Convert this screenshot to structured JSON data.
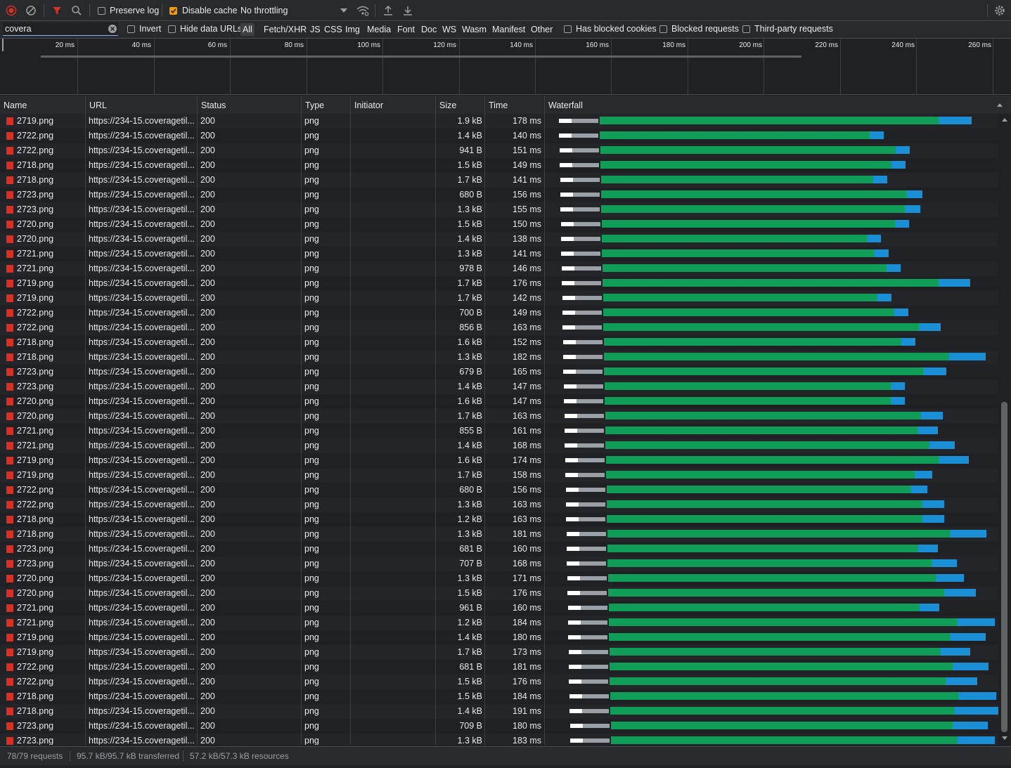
{
  "toolbar": {
    "preserve_log": "Preserve log",
    "disable_cache": "Disable cache",
    "throttling": "No throttling"
  },
  "filter": {
    "value": "covera",
    "invert": "Invert",
    "hide_data_urls": "Hide data URLs",
    "types": [
      "All",
      "Fetch/XHR",
      "JS",
      "CSS",
      "Img",
      "Media",
      "Font",
      "Doc",
      "WS",
      "Wasm",
      "Manifest",
      "Other"
    ],
    "has_blocked_cookies": "Has blocked cookies",
    "blocked_requests": "Blocked requests",
    "third_party": "Third-party requests"
  },
  "overview": {
    "ticks": [
      "20 ms",
      "40 ms",
      "60 ms",
      "80 ms",
      "100 ms",
      "120 ms",
      "140 ms",
      "160 ms",
      "180 ms",
      "200 ms",
      "220 ms",
      "240 ms",
      "260 ms"
    ]
  },
  "columns": {
    "name": "Name",
    "url": "URL",
    "status": "Status",
    "type": "Type",
    "initiator": "Initiator",
    "size": "Size",
    "time": "Time",
    "waterfall": "Waterfall"
  },
  "rows": [
    {
      "name": "2719.png",
      "url": "https://234-15.coveragetil...",
      "status": "200",
      "type": "png",
      "size": "1.9 kB",
      "time": "178 ms"
    },
    {
      "name": "2722.png",
      "url": "https://234-15.coveragetil...",
      "status": "200",
      "type": "png",
      "size": "1.4 kB",
      "time": "140 ms"
    },
    {
      "name": "2722.png",
      "url": "https://234-15.coveragetil...",
      "status": "200",
      "type": "png",
      "size": "941 B",
      "time": "151 ms"
    },
    {
      "name": "2718.png",
      "url": "https://234-15.coveragetil...",
      "status": "200",
      "type": "png",
      "size": "1.5 kB",
      "time": "149 ms"
    },
    {
      "name": "2718.png",
      "url": "https://234-15.coveragetil...",
      "status": "200",
      "type": "png",
      "size": "1.7 kB",
      "time": "141 ms"
    },
    {
      "name": "2723.png",
      "url": "https://234-15.coveragetil...",
      "status": "200",
      "type": "png",
      "size": "680 B",
      "time": "156 ms"
    },
    {
      "name": "2723.png",
      "url": "https://234-15.coveragetil...",
      "status": "200",
      "type": "png",
      "size": "1.3 kB",
      "time": "155 ms"
    },
    {
      "name": "2720.png",
      "url": "https://234-15.coveragetil...",
      "status": "200",
      "type": "png",
      "size": "1.5 kB",
      "time": "150 ms"
    },
    {
      "name": "2720.png",
      "url": "https://234-15.coveragetil...",
      "status": "200",
      "type": "png",
      "size": "1.4 kB",
      "time": "138 ms"
    },
    {
      "name": "2721.png",
      "url": "https://234-15.coveragetil...",
      "status": "200",
      "type": "png",
      "size": "1.3 kB",
      "time": "141 ms"
    },
    {
      "name": "2721.png",
      "url": "https://234-15.coveragetil...",
      "status": "200",
      "type": "png",
      "size": "978 B",
      "time": "146 ms"
    },
    {
      "name": "2719.png",
      "url": "https://234-15.coveragetil...",
      "status": "200",
      "type": "png",
      "size": "1.7 kB",
      "time": "176 ms"
    },
    {
      "name": "2719.png",
      "url": "https://234-15.coveragetil...",
      "status": "200",
      "type": "png",
      "size": "1.7 kB",
      "time": "142 ms"
    },
    {
      "name": "2722.png",
      "url": "https://234-15.coveragetil...",
      "status": "200",
      "type": "png",
      "size": "700 B",
      "time": "149 ms"
    },
    {
      "name": "2722.png",
      "url": "https://234-15.coveragetil...",
      "status": "200",
      "type": "png",
      "size": "856 B",
      "time": "163 ms"
    },
    {
      "name": "2718.png",
      "url": "https://234-15.coveragetil...",
      "status": "200",
      "type": "png",
      "size": "1.6 kB",
      "time": "152 ms"
    },
    {
      "name": "2718.png",
      "url": "https://234-15.coveragetil...",
      "status": "200",
      "type": "png",
      "size": "1.3 kB",
      "time": "182 ms"
    },
    {
      "name": "2723.png",
      "url": "https://234-15.coveragetil...",
      "status": "200",
      "type": "png",
      "size": "679 B",
      "time": "165 ms"
    },
    {
      "name": "2723.png",
      "url": "https://234-15.coveragetil...",
      "status": "200",
      "type": "png",
      "size": "1.4 kB",
      "time": "147 ms"
    },
    {
      "name": "2720.png",
      "url": "https://234-15.coveragetil...",
      "status": "200",
      "type": "png",
      "size": "1.6 kB",
      "time": "147 ms"
    },
    {
      "name": "2720.png",
      "url": "https://234-15.coveragetil...",
      "status": "200",
      "type": "png",
      "size": "1.7 kB",
      "time": "163 ms"
    },
    {
      "name": "2721.png",
      "url": "https://234-15.coveragetil...",
      "status": "200",
      "type": "png",
      "size": "855 B",
      "time": "161 ms"
    },
    {
      "name": "2721.png",
      "url": "https://234-15.coveragetil...",
      "status": "200",
      "type": "png",
      "size": "1.4 kB",
      "time": "168 ms"
    },
    {
      "name": "2719.png",
      "url": "https://234-15.coveragetil...",
      "status": "200",
      "type": "png",
      "size": "1.6 kB",
      "time": "174 ms"
    },
    {
      "name": "2719.png",
      "url": "https://234-15.coveragetil...",
      "status": "200",
      "type": "png",
      "size": "1.7 kB",
      "time": "158 ms"
    },
    {
      "name": "2722.png",
      "url": "https://234-15.coveragetil...",
      "status": "200",
      "type": "png",
      "size": "680 B",
      "time": "156 ms"
    },
    {
      "name": "2722.png",
      "url": "https://234-15.coveragetil...",
      "status": "200",
      "type": "png",
      "size": "1.3 kB",
      "time": "163 ms"
    },
    {
      "name": "2718.png",
      "url": "https://234-15.coveragetil...",
      "status": "200",
      "type": "png",
      "size": "1.2 kB",
      "time": "163 ms"
    },
    {
      "name": "2718.png",
      "url": "https://234-15.coveragetil...",
      "status": "200",
      "type": "png",
      "size": "1.3 kB",
      "time": "181 ms"
    },
    {
      "name": "2723.png",
      "url": "https://234-15.coveragetil...",
      "status": "200",
      "type": "png",
      "size": "681 B",
      "time": "160 ms"
    },
    {
      "name": "2723.png",
      "url": "https://234-15.coveragetil...",
      "status": "200",
      "type": "png",
      "size": "707 B",
      "time": "168 ms"
    },
    {
      "name": "2720.png",
      "url": "https://234-15.coveragetil...",
      "status": "200",
      "type": "png",
      "size": "1.3 kB",
      "time": "171 ms"
    },
    {
      "name": "2720.png",
      "url": "https://234-15.coveragetil...",
      "status": "200",
      "type": "png",
      "size": "1.5 kB",
      "time": "176 ms"
    },
    {
      "name": "2721.png",
      "url": "https://234-15.coveragetil...",
      "status": "200",
      "type": "png",
      "size": "961 B",
      "time": "160 ms"
    },
    {
      "name": "2721.png",
      "url": "https://234-15.coveragetil...",
      "status": "200",
      "type": "png",
      "size": "1.2 kB",
      "time": "184 ms"
    },
    {
      "name": "2719.png",
      "url": "https://234-15.coveragetil...",
      "status": "200",
      "type": "png",
      "size": "1.4 kB",
      "time": "180 ms"
    },
    {
      "name": "2719.png",
      "url": "https://234-15.coveragetil...",
      "status": "200",
      "type": "png",
      "size": "1.7 kB",
      "time": "173 ms"
    },
    {
      "name": "2722.png",
      "url": "https://234-15.coveragetil...",
      "status": "200",
      "type": "png",
      "size": "681 B",
      "time": "181 ms"
    },
    {
      "name": "2722.png",
      "url": "https://234-15.coveragetil...",
      "status": "200",
      "type": "png",
      "size": "1.5 kB",
      "time": "176 ms"
    },
    {
      "name": "2718.png",
      "url": "https://234-15.coveragetil...",
      "status": "200",
      "type": "png",
      "size": "1.5 kB",
      "time": "184 ms"
    },
    {
      "name": "2718.png",
      "url": "https://234-15.coveragetil...",
      "status": "200",
      "type": "png",
      "size": "1.4 kB",
      "time": "191 ms"
    },
    {
      "name": "2723.png",
      "url": "https://234-15.coveragetil...",
      "status": "200",
      "type": "png",
      "size": "709 B",
      "time": "180 ms"
    },
    {
      "name": "2723.png",
      "url": "https://234-15.coveragetil...",
      "status": "200",
      "type": "png",
      "size": "1.3 kB",
      "time": "183 ms"
    }
  ],
  "status_bar": {
    "requests": "78/79 requests",
    "transferred": "95.7 kB/95.7 kB transferred",
    "resources": "57.2 kB/57.3 kB resources"
  },
  "colors": {
    "record": "#d93025",
    "filter_active": "#d93025",
    "checkbox_checked": "#f29900",
    "waiting": "#0f9d58",
    "download": "#1a8fd6",
    "file_icon": "#d93025"
  }
}
